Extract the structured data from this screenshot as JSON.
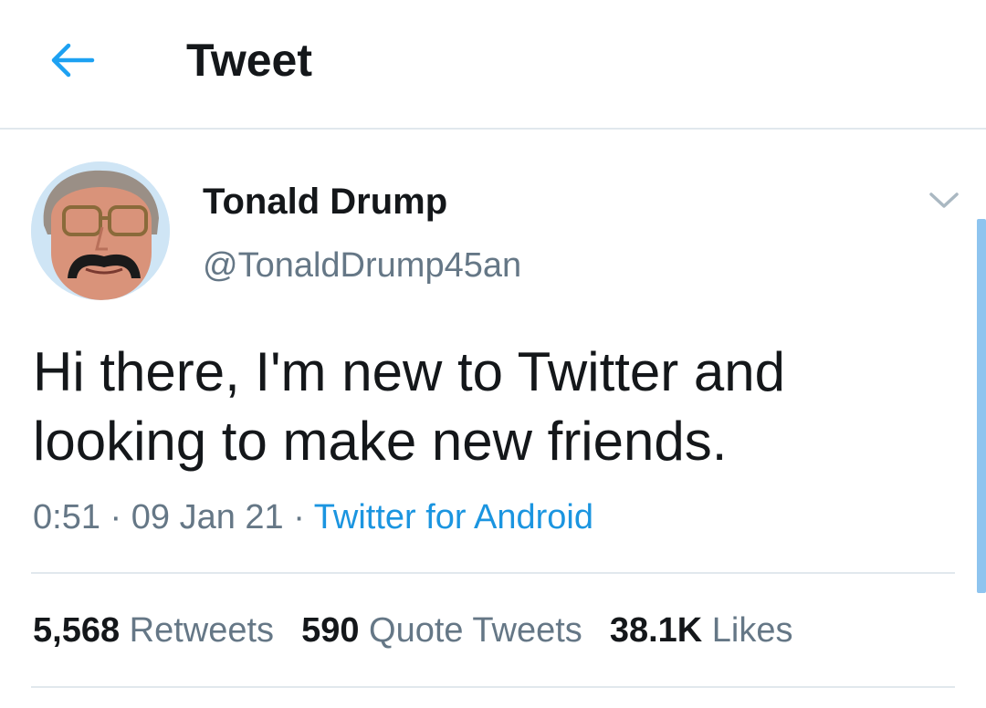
{
  "header": {
    "title": "Tweet",
    "back_icon": "arrow-left-icon",
    "accent_color": "#1da1f2"
  },
  "tweet": {
    "author": {
      "name": "Tonald Drump",
      "handle": "@TonaldDrump45an"
    },
    "text": "Hi there, I'm new to Twitter and looking to make new friends.",
    "time": "0:51",
    "separator": " · ",
    "date": "09 Jan 21",
    "source": "Twitter for Android",
    "source_color": "#1b95e0",
    "menu_icon": "chevron-down-icon"
  },
  "stats": {
    "retweets": {
      "count": "5,568",
      "label": "Retweets"
    },
    "quotes": {
      "count": "590",
      "label": "Quote Tweets"
    },
    "likes": {
      "count": "38.1K",
      "label": "Likes"
    }
  }
}
